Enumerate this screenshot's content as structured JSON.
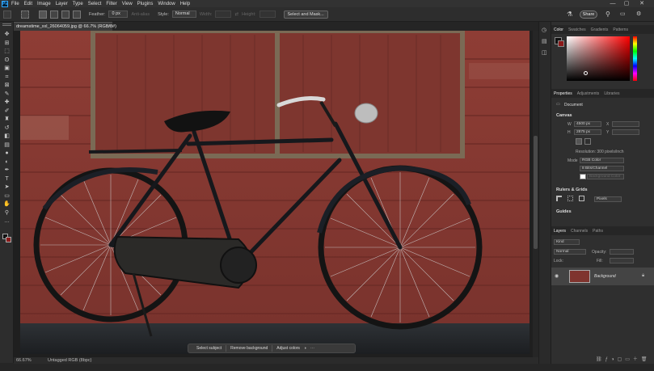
{
  "app": {
    "logo_text": "Ps"
  },
  "menu": [
    "File",
    "Edit",
    "Image",
    "Layer",
    "Type",
    "Select",
    "Filter",
    "View",
    "Plugins",
    "Window",
    "Help"
  ],
  "window_controls": {
    "minimize": "—",
    "maximize": "▢",
    "close": "✕"
  },
  "options_bar": {
    "feather_label": "Feather:",
    "feather_value": "0 px",
    "antialias_label": "Anti-alias",
    "style_label": "Style:",
    "style_value": "Normal",
    "width_label": "Width:",
    "height_label": "Height:",
    "select_mask_label": "Select and Mask...",
    "share_label": "Share"
  },
  "document_tab": {
    "title": "dreamstime_xxl_26064059.jpg @ 66.7% (RGB/8#)",
    "close": "×"
  },
  "toolbar": {
    "tools": [
      {
        "name": "move-tool",
        "glyph": "✥"
      },
      {
        "name": "artboard-tool",
        "glyph": "⊞"
      },
      {
        "name": "marquee-tool",
        "glyph": "⬚"
      },
      {
        "name": "lasso-tool",
        "glyph": "ʘ"
      },
      {
        "name": "object-select-tool",
        "glyph": "▣"
      },
      {
        "name": "crop-tool",
        "glyph": "⌗"
      },
      {
        "name": "frame-tool",
        "glyph": "⊠"
      },
      {
        "name": "eyedropper-tool",
        "glyph": "✎"
      },
      {
        "name": "healing-tool",
        "glyph": "✚"
      },
      {
        "name": "brush-tool",
        "glyph": "✐"
      },
      {
        "name": "clone-stamp-tool",
        "glyph": "♜"
      },
      {
        "name": "history-brush-tool",
        "glyph": "↺"
      },
      {
        "name": "eraser-tool",
        "glyph": "◧"
      },
      {
        "name": "gradient-tool",
        "glyph": "▤"
      },
      {
        "name": "blur-tool",
        "glyph": "●"
      },
      {
        "name": "dodge-tool",
        "glyph": "◐"
      },
      {
        "name": "pen-tool",
        "glyph": "✒"
      },
      {
        "name": "type-tool",
        "glyph": "T"
      },
      {
        "name": "path-select-tool",
        "glyph": "➤"
      },
      {
        "name": "rectangle-tool",
        "glyph": "▭"
      },
      {
        "name": "hand-tool",
        "glyph": "✋"
      },
      {
        "name": "zoom-tool",
        "glyph": "⚲"
      },
      {
        "name": "more-tools",
        "glyph": "…"
      }
    ]
  },
  "context_bar": {
    "select_subject": "Select subject",
    "remove_background": "Remove background",
    "adjust_colors": "Adjust colors"
  },
  "status": {
    "zoom": "66.67%",
    "profile": "Untagged RGB (8bpc)"
  },
  "panels": {
    "color_tabs": [
      "Color",
      "Swatches",
      "Gradients",
      "Patterns"
    ],
    "properties_tabs": [
      "Properties",
      "Adjustments",
      "Libraries"
    ],
    "properties": {
      "document_label": "Document",
      "canvas_label": "Canvas",
      "w_label": "W",
      "w_value": "4500 px",
      "h_label": "H",
      "h_value": "2875 px",
      "x_label": "X",
      "y_label": "Y",
      "resolution": "Resolution: 300 pixels/inch",
      "mode_label": "Mode",
      "mode_value": "RGB Color",
      "bit_value": "8 Bits/Channel",
      "fill_value": "Background Color",
      "rulers_label": "Rulers & Grids",
      "units_value": "Pixels",
      "guides_label": "Guides"
    },
    "layers_tabs": [
      "Layers",
      "Channels",
      "Paths"
    ],
    "layers": {
      "kind_value": "Kind",
      "blend_value": "Normal",
      "opacity_label": "Opacity:",
      "lock_label": "Lock:",
      "fill_label": "Fill:",
      "background_layer": "Background"
    }
  },
  "colors": {
    "accent": "#31a8ff",
    "app_bg": "#262626",
    "panel": "#2f2f2f",
    "wall": "#8a3a33"
  }
}
